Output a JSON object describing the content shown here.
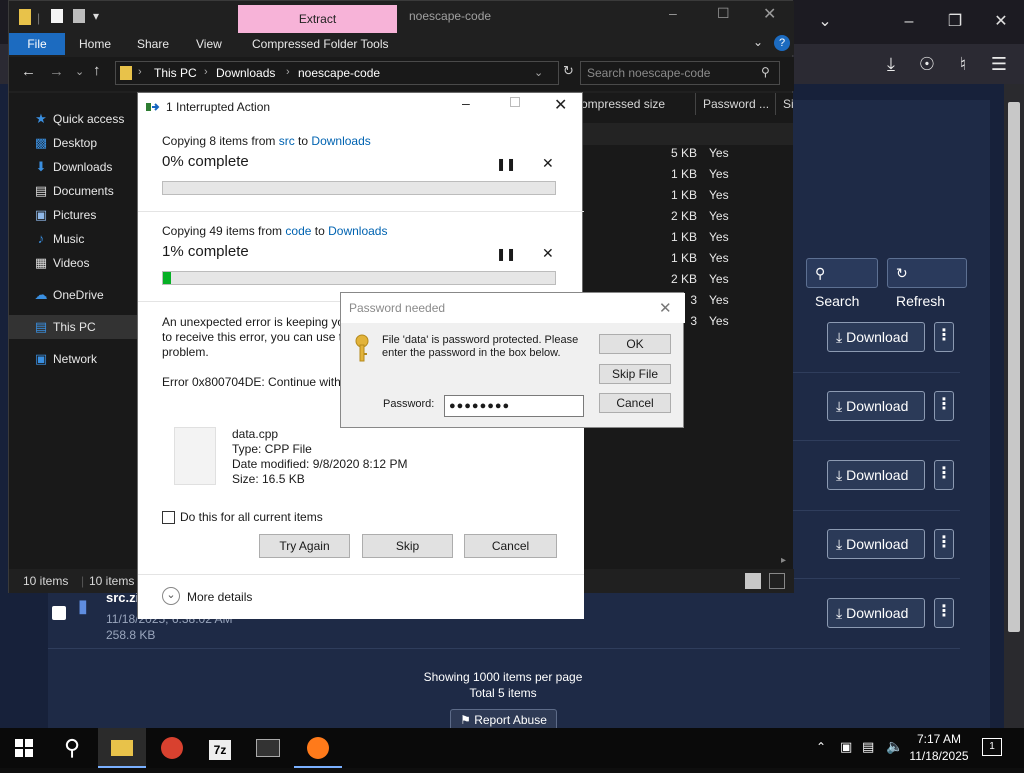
{
  "browser": {
    "buttons": {
      "search": "Search",
      "refresh": "Refresh",
      "download": "Download"
    },
    "download_rows": 5,
    "file_row": {
      "name": "src.zi",
      "date": "11/18/2025, 6:38:02 AM",
      "size": "258.8 KB"
    },
    "footer": {
      "per_page": "Showing 1000 items per page",
      "total": "Total 5 items",
      "report": "Report Abuse"
    }
  },
  "explorer": {
    "extract_tab": "Extract",
    "title": "noescape-code",
    "ribbon": {
      "file": "File",
      "home": "Home",
      "share": "Share",
      "view": "View",
      "compressed": "Compressed Folder Tools"
    },
    "address": {
      "root": "This PC",
      "p1": "Downloads",
      "p2": "noescape-code"
    },
    "search_placeholder": "Search noescape-code",
    "nav": {
      "quick_access": "Quick access",
      "desktop": "Desktop",
      "downloads": "Downloads",
      "documents": "Documents",
      "pictures": "Pictures",
      "music": "Music",
      "videos": "Videos",
      "onedrive": "OneDrive",
      "this_pc": "This PC",
      "network": "Network"
    },
    "columns": {
      "compressed_size": "ompressed size",
      "password": "Password ...",
      "size": "Si"
    },
    "rows": [
      {
        "size": "5 KB",
        "pwd": "Yes"
      },
      {
        "size": "1 KB",
        "pwd": "Yes"
      },
      {
        "size": "1 KB",
        "pwd": "Yes"
      },
      {
        "size": "2 KB",
        "pwd": "Yes"
      },
      {
        "size": "1 KB",
        "pwd": "Yes"
      },
      {
        "size": "1 KB",
        "pwd": "Yes"
      },
      {
        "size": "2 KB",
        "pwd": "Yes"
      },
      {
        "size": "3",
        "pwd": "Yes"
      },
      {
        "size": "3",
        "pwd": "Yes"
      }
    ],
    "status": {
      "count": "10 items",
      "count2": "10 items"
    }
  },
  "interrupt": {
    "title": "1 Interrupted Action",
    "op1": {
      "prefix": "Copying 8 items from ",
      "src": "src",
      "mid": " to ",
      "dst": "Downloads",
      "pct": "0% complete",
      "progress": 0
    },
    "op2": {
      "prefix": "Copying 49 items from ",
      "src": "code",
      "mid": " to ",
      "dst": "Downloads",
      "pct": "1% complete",
      "progress": 0.01
    },
    "error_line1": "An unexpected error is keeping you",
    "error_line2": "to receive this error, you can use t",
    "error_line3": "problem.",
    "error_code": "Error 0x800704DE: Continue with w",
    "file": {
      "name": "data.cpp",
      "type": "Type: CPP File",
      "modified": "Date modified: 9/8/2020 8:12 PM",
      "size": "Size: 16.5 KB"
    },
    "checkbox": "Do this for all current items",
    "buttons": {
      "try_again": "Try Again",
      "skip": "Skip",
      "cancel": "Cancel"
    },
    "more_details": "More details"
  },
  "password": {
    "title": "Password needed",
    "message_line1": "File 'data' is password protected.  Please",
    "message_line2": "enter the password in the box below.",
    "label": "Password:",
    "value": "●●●●●●●●",
    "buttons": {
      "ok": "OK",
      "skip_file": "Skip File",
      "cancel": "Cancel"
    }
  },
  "taskbar": {
    "time": "7:17 AM",
    "date": "11/18/2025",
    "notification_count": "1",
    "sevenzip_label": "7z"
  }
}
